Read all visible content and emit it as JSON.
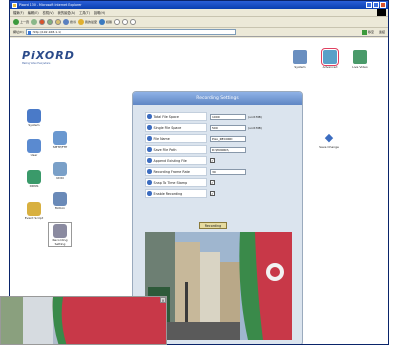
{
  "window": {
    "title": "Pixord 130 - Microsoft Internet Explorer",
    "menu": [
      "檔案(F)",
      "編輯(E)",
      "檢視(V)",
      "我的最愛(A)",
      "工具(T)",
      "說明(H)"
    ],
    "toolbar": {
      "back": "上一頁",
      "search": "搜尋",
      "favorites": "我的最愛",
      "media": "媒體"
    },
    "address_label": "網址(D)",
    "address_value": "http://192.168.1.1/",
    "go_label": "移至",
    "links_label": "連結"
  },
  "logo": {
    "text": "PiXORD",
    "tagline": "Making Video Everywhere"
  },
  "top_nav": [
    {
      "label": "System",
      "color": "#6a8fc0"
    },
    {
      "label": "Advanced",
      "color": "#5aa0c8"
    },
    {
      "label": "Live Video",
      "color": "#4a9a6a"
    }
  ],
  "side_nav": [
    {
      "label": "System",
      "color": "#4a7ac8"
    },
    {
      "label": "SMTP/FTP",
      "color": "#6a98d0"
    },
    {
      "label": "User",
      "color": "#5a8ad0"
    },
    {
      "label": "UDIO",
      "color": "#7aa0c8"
    },
    {
      "label": "DDNS",
      "color": "#3a9a6a"
    },
    {
      "label": "Motion",
      "color": "#6a8ab8"
    },
    {
      "label": "Event Script",
      "color": "#d8b040"
    },
    {
      "label": "Recording Setting",
      "color": "#8a8aa0"
    }
  ],
  "save_change": {
    "label": "Save Change"
  },
  "panel": {
    "title": "Recording Settings",
    "rows": [
      {
        "label": "Total File Space",
        "value": "1000",
        "unit": "(unit:MB)",
        "kind": "text"
      },
      {
        "label": "Single File Space",
        "value": "500",
        "unit": "(unit:MB)",
        "kind": "text"
      },
      {
        "label": "File Name",
        "value": "Pixo_RECORD",
        "unit": "",
        "kind": "text"
      },
      {
        "label": "Save File Path",
        "value": "D:\\PIXORD\\",
        "unit": "",
        "kind": "text"
      },
      {
        "label": "Append Existing File",
        "value": "✓",
        "unit": "",
        "kind": "check"
      },
      {
        "label": "Recording Frame Rate",
        "value": "30",
        "unit": "",
        "kind": "text"
      },
      {
        "label": "Snap To Time Stamp",
        "value": "✓",
        "unit": "",
        "kind": "check"
      },
      {
        "label": "Enable Recording",
        "value": "✓",
        "unit": "",
        "kind": "check"
      }
    ],
    "record_button": "Recording"
  },
  "colors": {
    "accent": "#3b6cc0",
    "panel_bg": "#dbe4ee",
    "header": "#6f94cc"
  }
}
